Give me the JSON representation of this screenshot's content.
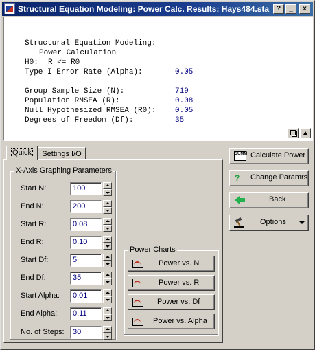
{
  "window": {
    "title": "Structural Equation Modeling: Power Calc. Results: Hays484.sta",
    "help_label": "?",
    "minimize_label": "_",
    "close_label": "x"
  },
  "output": {
    "heading1": "Structural Equation Modeling:",
    "heading2": "Power Calculation",
    "h0_label": "H0:",
    "h0_value": "R <= R0",
    "alpha_label": "Type I Error Rate (Alpha):",
    "alpha_value": "0.05",
    "n_label": "Group Sample Size (N):",
    "n_value": "719",
    "rmsea_label": "Population RMSEA (R):",
    "rmsea_value": "0.08",
    "null_label": "Null Hypothesized RMSEA (R0):",
    "null_value": "0.05",
    "df_label": "Degrees of Freedom (Df):",
    "df_value": "35"
  },
  "tabs": {
    "quick": "Quick",
    "settings": "Settings I/O"
  },
  "graphing": {
    "legend": "X-Axis Graphing Parameters",
    "fields": [
      {
        "label": "Start N:",
        "value": "100"
      },
      {
        "label": "End N:",
        "value": "200"
      },
      {
        "label": "Start R:",
        "value": "0.08"
      },
      {
        "label": "End R:",
        "value": "0.10"
      },
      {
        "label": "Start Df:",
        "value": "5"
      },
      {
        "label": "End Df:",
        "value": "35"
      },
      {
        "label": "Start Alpha:",
        "value": "0.01"
      },
      {
        "label": "End Alpha:",
        "value": "0.11"
      },
      {
        "label": "No. of Steps:",
        "value": "30"
      }
    ]
  },
  "power_charts": {
    "legend": "Power Charts",
    "buttons": [
      "Power vs. N",
      "Power vs. R",
      "Power vs. Df",
      "Power vs. Alpha"
    ]
  },
  "actions": {
    "calculate": "Calculate Power",
    "calc_icon_text": "SUMM",
    "change": "Change Paramrs",
    "back": "Back",
    "options": "Options"
  },
  "colors": {
    "title_bar": "#0a246a",
    "value_text": "#000080",
    "back_arrow": "#22b14c"
  }
}
